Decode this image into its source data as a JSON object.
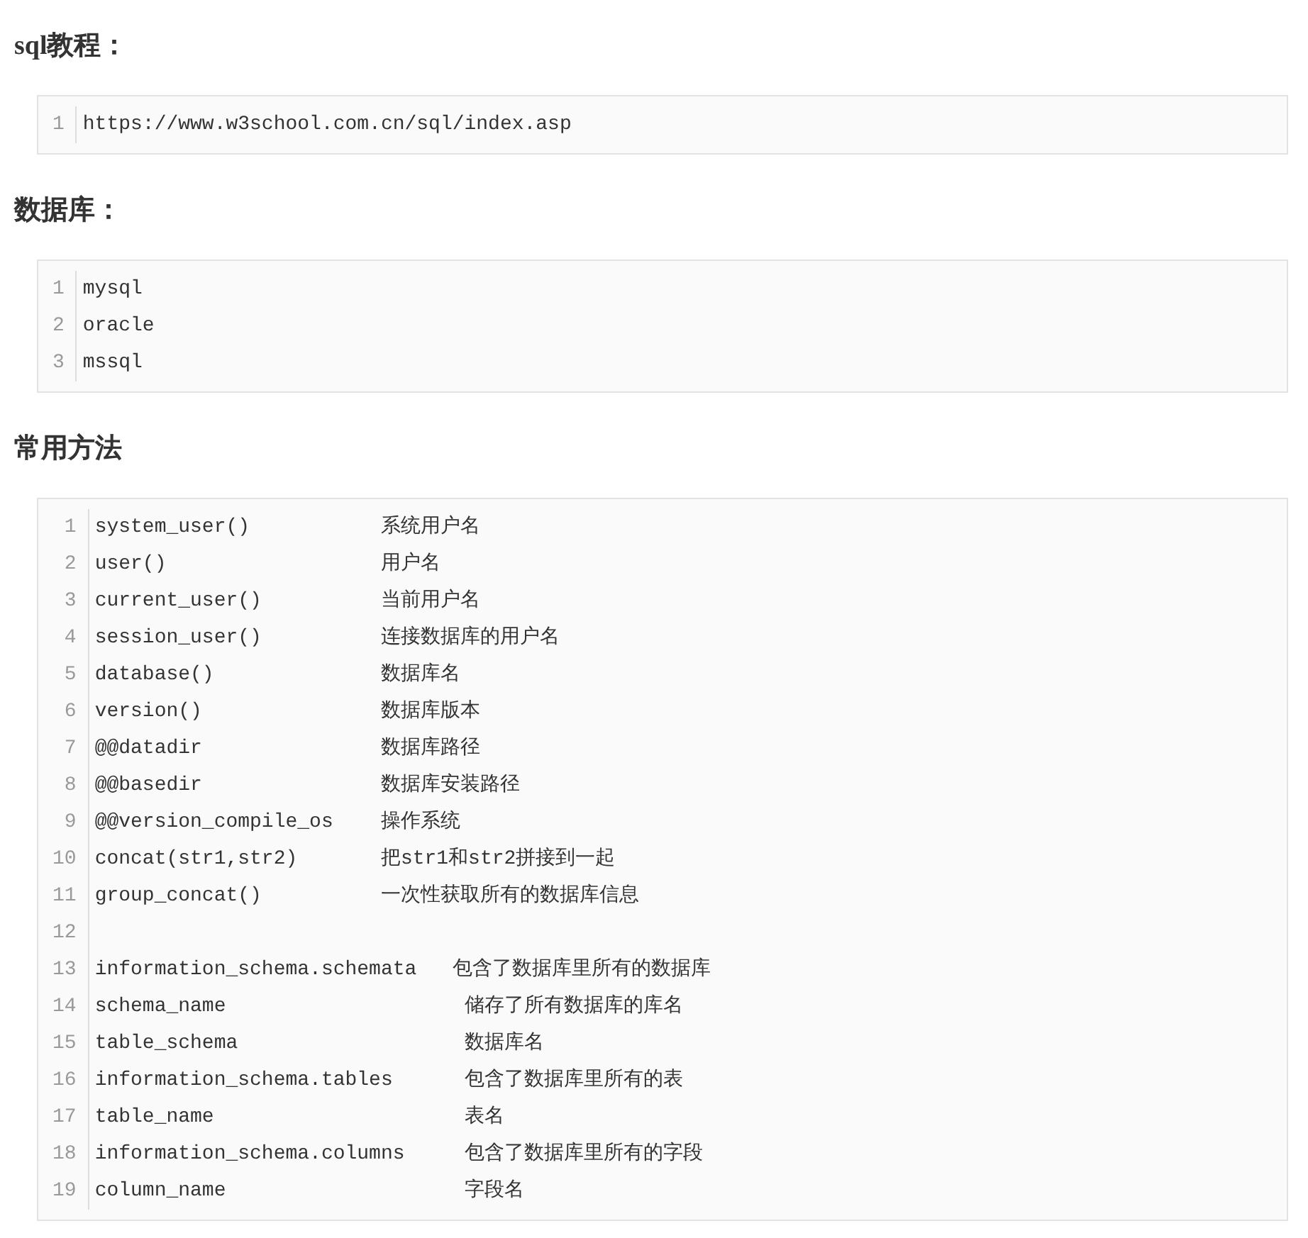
{
  "sections": [
    {
      "heading": "sql教程：",
      "lines": [
        {
          "number": "1",
          "code": "https://www.w3school.com.cn/sql/index.asp"
        }
      ]
    },
    {
      "heading": "数据库：",
      "lines": [
        {
          "number": "1",
          "code": "mysql"
        },
        {
          "number": "2",
          "code": "oracle"
        },
        {
          "number": "3",
          "code": "mssql"
        }
      ]
    },
    {
      "heading": "常用方法",
      "lines": [
        {
          "number": "1",
          "code": "system_user()           系统用户名"
        },
        {
          "number": "2",
          "code": "user()                  用户名"
        },
        {
          "number": "3",
          "code": "current_user()          当前用户名"
        },
        {
          "number": "4",
          "code": "session_user()          连接数据库的用户名"
        },
        {
          "number": "5",
          "code": "database()              数据库名"
        },
        {
          "number": "6",
          "code": "version()               数据库版本"
        },
        {
          "number": "7",
          "code": "@@datadir               数据库路径"
        },
        {
          "number": "8",
          "code": "@@basedir               数据库安装路径"
        },
        {
          "number": "9",
          "code": "@@version_compile_os    操作系统"
        },
        {
          "number": "10",
          "code": "concat(str1,str2)       把str1和str2拼接到一起"
        },
        {
          "number": "11",
          "code": "group_concat()          一次性获取所有的数据库信息"
        },
        {
          "number": "12"
        },
        {
          "number": "13",
          "code": "information_schema.schemata   包含了数据库里所有的数据库"
        },
        {
          "number": "14",
          "code": "schema_name                    储存了所有数据库的库名"
        },
        {
          "number": "15",
          "code": "table_schema                   数据库名"
        },
        {
          "number": "16",
          "code": "information_schema.tables      包含了数据库里所有的表"
        },
        {
          "number": "17",
          "code": "table_name                     表名"
        },
        {
          "number": "18",
          "code": "information_schema.columns     包含了数据库里所有的字段"
        },
        {
          "number": "19",
          "code": "column_name                    字段名"
        }
      ]
    }
  ]
}
